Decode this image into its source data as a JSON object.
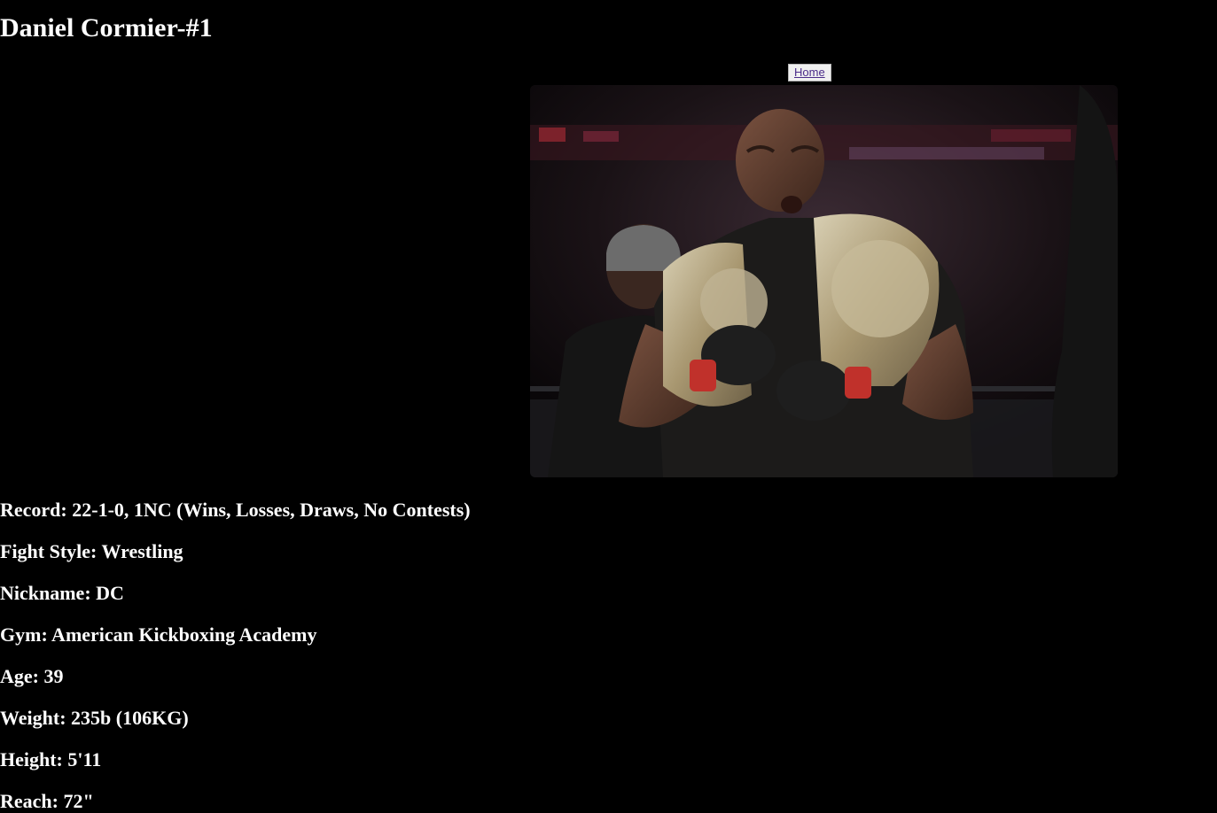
{
  "page": {
    "title": "Daniel Cormier-#1"
  },
  "nav": {
    "home_label": "Home"
  },
  "photo": {
    "alt": "Daniel Cormier"
  },
  "stats": [
    {
      "label": "Record: 22-1-0, 1NC (Wins, Losses, Draws, No Contests)"
    },
    {
      "label": "Fight Style: Wrestling"
    },
    {
      "label": "Nickname: DC"
    },
    {
      "label": "Gym: American Kickboxing Academy"
    },
    {
      "label": "Age: 39"
    },
    {
      "label": "Weight: 235b (106KG)"
    },
    {
      "label": "Height: 5'11"
    },
    {
      "label": "Reach: 72\""
    }
  ],
  "colors": {
    "background": "#000000",
    "text": "#ffffff",
    "link": "#4b2c8a"
  }
}
